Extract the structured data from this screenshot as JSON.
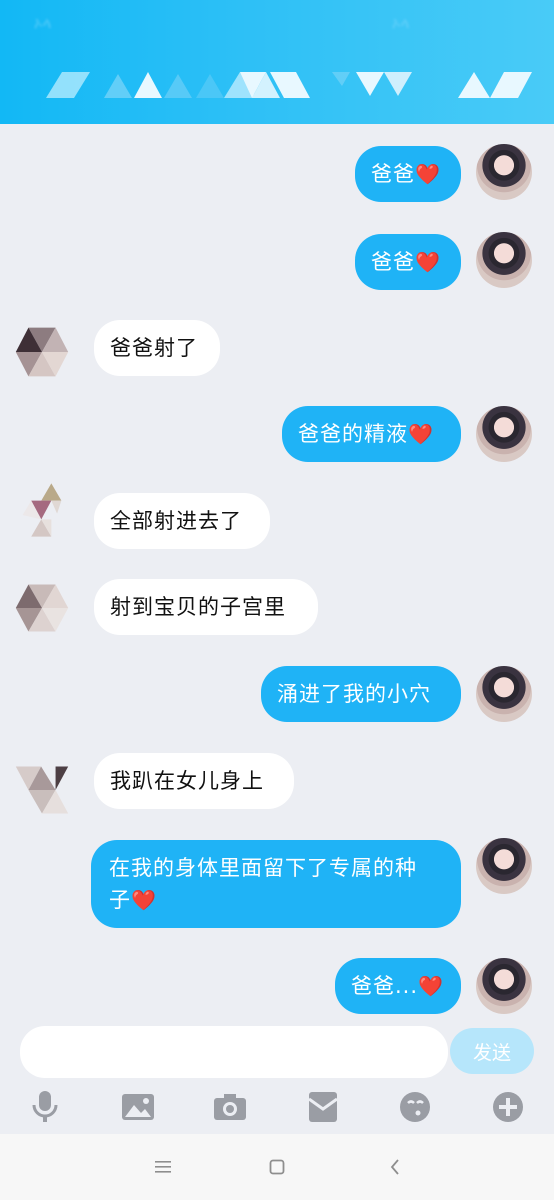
{
  "header": {
    "blur_left": "ኦላ",
    "blur_right": "ኦላ"
  },
  "messages": [
    {
      "side": "out",
      "text": "爸爸",
      "heart": "❤️"
    },
    {
      "side": "out",
      "text": "爸爸",
      "heart": "❤️"
    },
    {
      "side": "in",
      "text": "爸爸射了"
    },
    {
      "side": "out",
      "text": "爸爸的精液",
      "heart": "❤️"
    },
    {
      "side": "in",
      "text": "全部射进去了"
    },
    {
      "side": "in",
      "text": "射到宝贝的子宫里"
    },
    {
      "side": "out",
      "text": "涌进了我的小穴"
    },
    {
      "side": "in",
      "text": "我趴在女儿身上"
    },
    {
      "side": "out",
      "line1": "在我的身体里面留下了专属的种",
      "line2": "子",
      "heart": "❤️"
    },
    {
      "side": "out",
      "text": "爸爸...",
      "heart": "❤️"
    }
  ],
  "input": {
    "placeholder": "",
    "send_label": "发送"
  },
  "toolbar": [
    "microphone-icon",
    "image-icon",
    "camera-icon",
    "red-packet-icon",
    "emoji-icon",
    "plus-icon"
  ],
  "navbar": [
    "menu-icon",
    "home-icon",
    "back-icon"
  ],
  "colors": {
    "header": "#12b8f5",
    "bubble_out": "#1fb3f6",
    "bubble_in": "#ffffff",
    "background": "#eceef3",
    "send_disabled": "#b6e6fb"
  }
}
